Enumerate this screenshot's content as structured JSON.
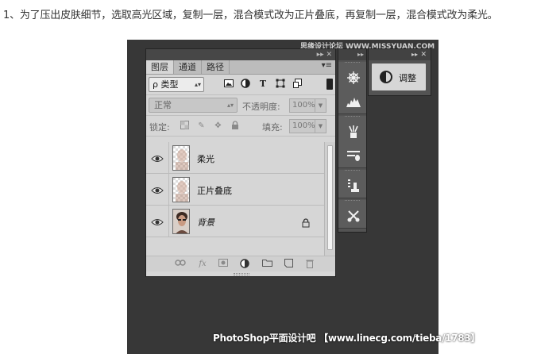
{
  "instruction": "1、为了压出皮肤细节，选取高光区域，复制一层，混合模式改为正片叠底，再复制一层，混合模式改为柔光。",
  "watermark_top": "思缘设计论坛 WWW.MISSYUAN.COM",
  "watermark_bottom": "PhotoShop平面设计吧 【www.linecg.com/tieba/1783】",
  "layers_panel": {
    "strip_controls": "▸▸ ✕",
    "tabs": [
      "图层",
      "通道",
      "路径"
    ],
    "menu_icon": "hamburger-menu-icon",
    "filter": {
      "label": "ρ 类型",
      "icons": [
        "image-filter-icon",
        "adjustment-filter-icon",
        "type-filter-icon",
        "shape-filter-icon",
        "smart-object-filter-icon"
      ]
    },
    "blend_mode": "正常",
    "opacity_label": "不透明度:",
    "opacity_value": "100%",
    "lock_label": "锁定:",
    "fill_label": "填充:",
    "fill_value": "100%",
    "layers": [
      {
        "name": "柔光",
        "visible": true,
        "locked": false,
        "italic": false,
        "thumb": "transparent"
      },
      {
        "name": "正片叠底",
        "visible": true,
        "locked": false,
        "italic": false,
        "thumb": "transparent"
      },
      {
        "name": "背景",
        "visible": true,
        "locked": true,
        "italic": true,
        "thumb": "portrait"
      }
    ],
    "bottom_icons": [
      "link-icon",
      "fx-icon",
      "mask-icon",
      "adjustment-layer-icon",
      "folder-icon",
      "new-layer-icon",
      "trash-icon"
    ],
    "fx_label": "fx"
  },
  "side_dock": {
    "strip_controls": "▸▸",
    "buttons": [
      "navigator-wheel-icon",
      "histogram-icon",
      "brushes-icon",
      "brush-presets-icon",
      "clone-source-icon",
      "tool-presets-icon"
    ]
  },
  "adjust_panel": {
    "strip_controls": "▸▸",
    "close": "✕",
    "label": "调整",
    "icon": "adjustments-circle-icon"
  }
}
